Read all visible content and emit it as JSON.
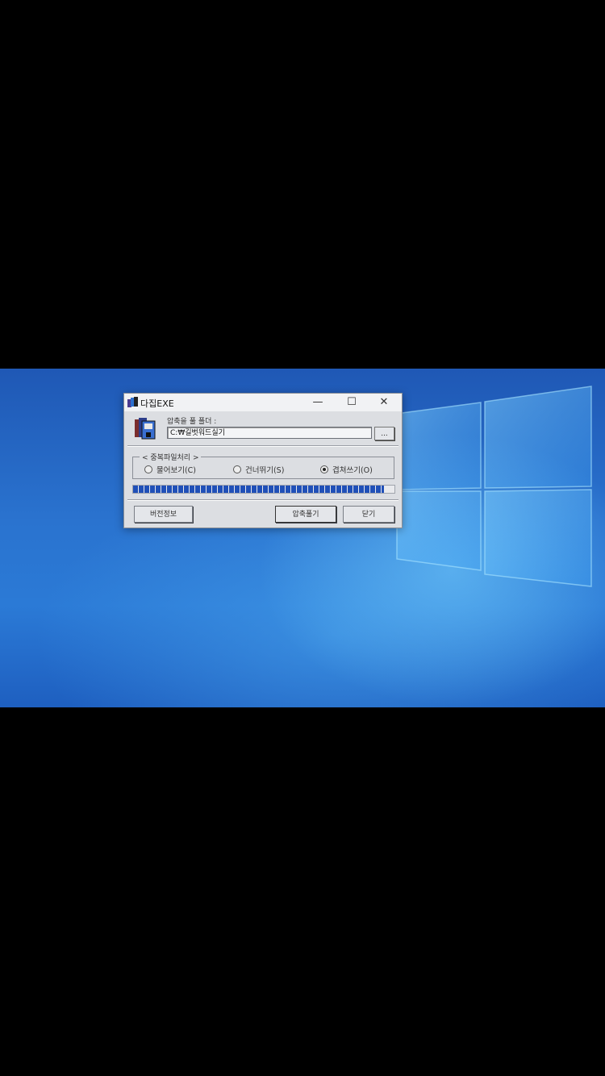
{
  "window": {
    "title": "다집EXE",
    "minimize_label": "—",
    "maximize_label": "☐",
    "close_label": "✕",
    "folder_label": "압축을 풀 폴더 :",
    "folder_path": "C:₩길벗워드실기",
    "browse_label": "...",
    "duplicate_group": {
      "legend": "< 중복파일처리 >",
      "options": [
        {
          "label": "물어보기(C)",
          "selected": false
        },
        {
          "label": "건너뛰기(S)",
          "selected": false
        },
        {
          "label": "겹쳐쓰기(O)",
          "selected": true
        }
      ]
    },
    "progress_fraction": 0.96,
    "buttons": {
      "version": "버전정보",
      "extract": "압축풀기",
      "close": "닫기"
    }
  },
  "colors": {
    "desktop_blue": "#2a73cf",
    "progress_blue": "#2050b8"
  },
  "icons": [
    "app-icon",
    "archive-icon",
    "windows-logo-icon"
  ]
}
